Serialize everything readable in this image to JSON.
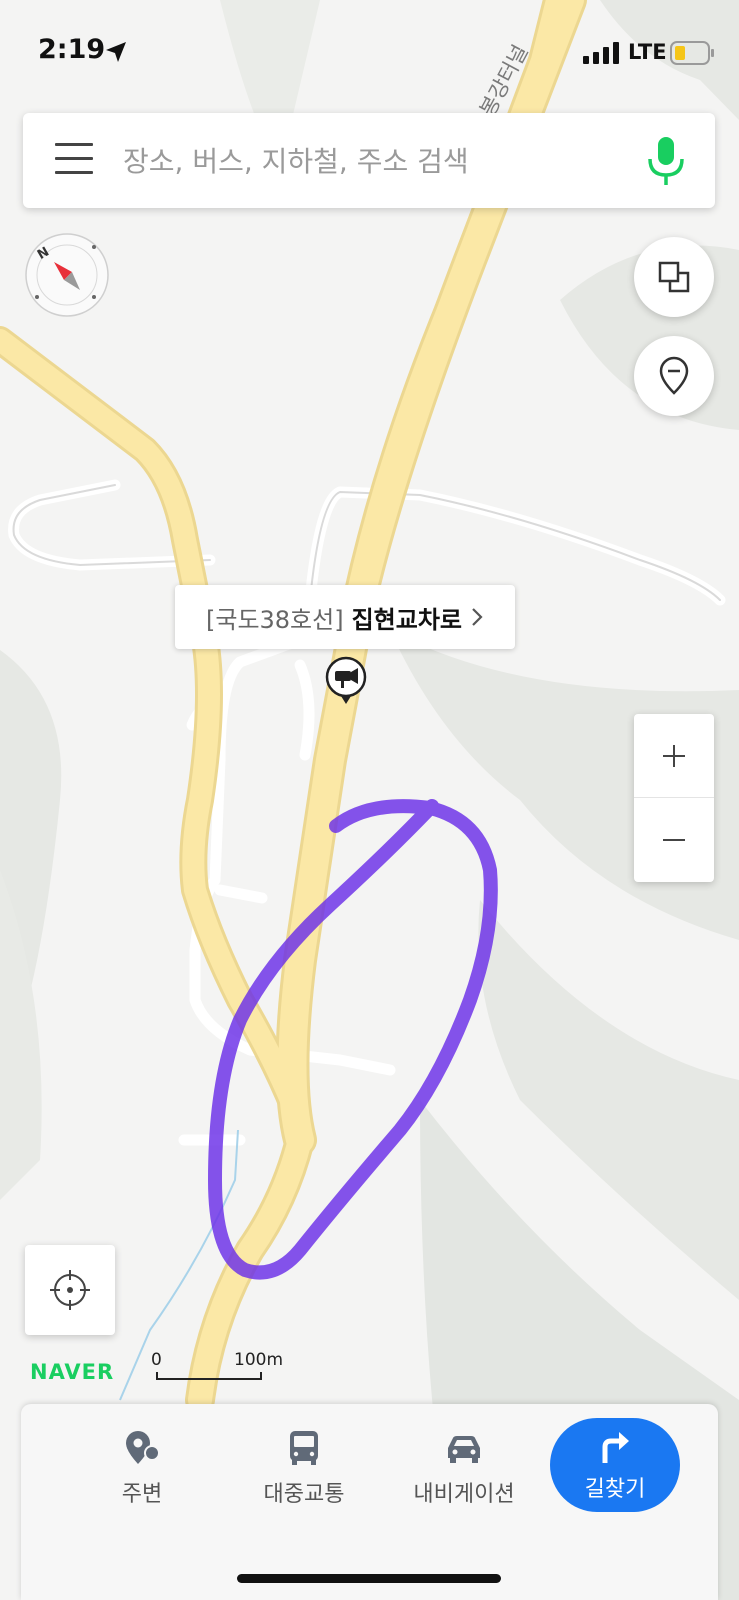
{
  "status_bar": {
    "time": "2:19",
    "network": "LTE",
    "location_icon": "location-arrow-icon",
    "battery_color": "#f5c518"
  },
  "search": {
    "placeholder": "장소, 버스, 지하철, 주소 검색",
    "menu_icon": "hamburger-menu-icon",
    "mic_icon": "microphone-icon",
    "mic_color": "#19ce60"
  },
  "map": {
    "tunnel_label": "봉강터널",
    "place_label": {
      "road": "[국도38호선]",
      "name": "집현교차로"
    },
    "annotation_color": "#6a2ee8",
    "road_color": "#fbe8a6"
  },
  "controls": {
    "compass_letter": "N",
    "zoom_in": "+",
    "zoom_out": "−"
  },
  "branding": {
    "logo": "NAVER",
    "logo_color": "#19ce60"
  },
  "scale": {
    "zero": "0",
    "max": "100m"
  },
  "bottom_tabs": [
    {
      "label": "주변",
      "icon": "nearby-pin-icon"
    },
    {
      "label": "대중교통",
      "icon": "bus-icon"
    },
    {
      "label": "내비게이션",
      "icon": "car-icon"
    },
    {
      "label": "길찾기",
      "icon": "turn-right-arrow-icon",
      "color": "#1a78f2"
    }
  ]
}
